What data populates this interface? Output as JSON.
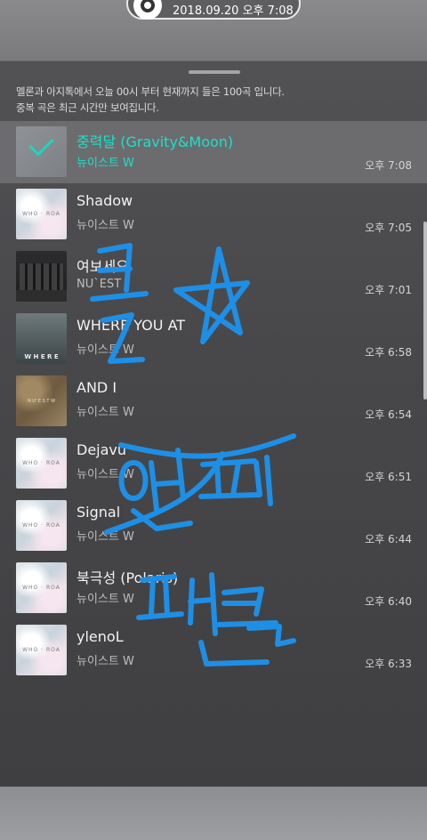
{
  "status": {
    "timestamp": "2018.09.20 오후 7:08"
  },
  "header": {
    "line1": "멜론과 아지톡에서 오늘 00시 부터 현재까지 들은 100곡 입니다.",
    "line2": "중복 곡은 최근 시간만 보여집니다."
  },
  "songs": [
    {
      "title": "중력달 (Gravity&Moon)",
      "artist": "뉴이스트 W",
      "time": "오후 7:08",
      "selected": true
    },
    {
      "title": "Shadow",
      "artist": "뉴이스트 W",
      "time": "오후 7:05"
    },
    {
      "title": "여보세요",
      "artist": "NU`EST",
      "time": "오후 7:01"
    },
    {
      "title": "WHERE YOU AT",
      "artist": "뉴이스트 W",
      "time": "오후 6:58"
    },
    {
      "title": "AND I",
      "artist": "뉴이스트 W",
      "time": "오후 6:54"
    },
    {
      "title": "Dejavu",
      "artist": "뉴이스트 W",
      "time": "오후 6:51"
    },
    {
      "title": "Signal",
      "artist": "뉴이스트 W",
      "time": "오후 6:44"
    },
    {
      "title": "북극성 (Polaris)",
      "artist": "뉴이스트 W",
      "time": "오후 6:40"
    },
    {
      "title": "ylenoL",
      "artist": "뉴이스트 W",
      "time": "오후 6:33"
    }
  ],
  "colors": {
    "accent": "#1be0c8",
    "handwriting": "#1e8fe6"
  },
  "icons": {
    "app": "disc-icon",
    "selected": "check-icon"
  }
}
